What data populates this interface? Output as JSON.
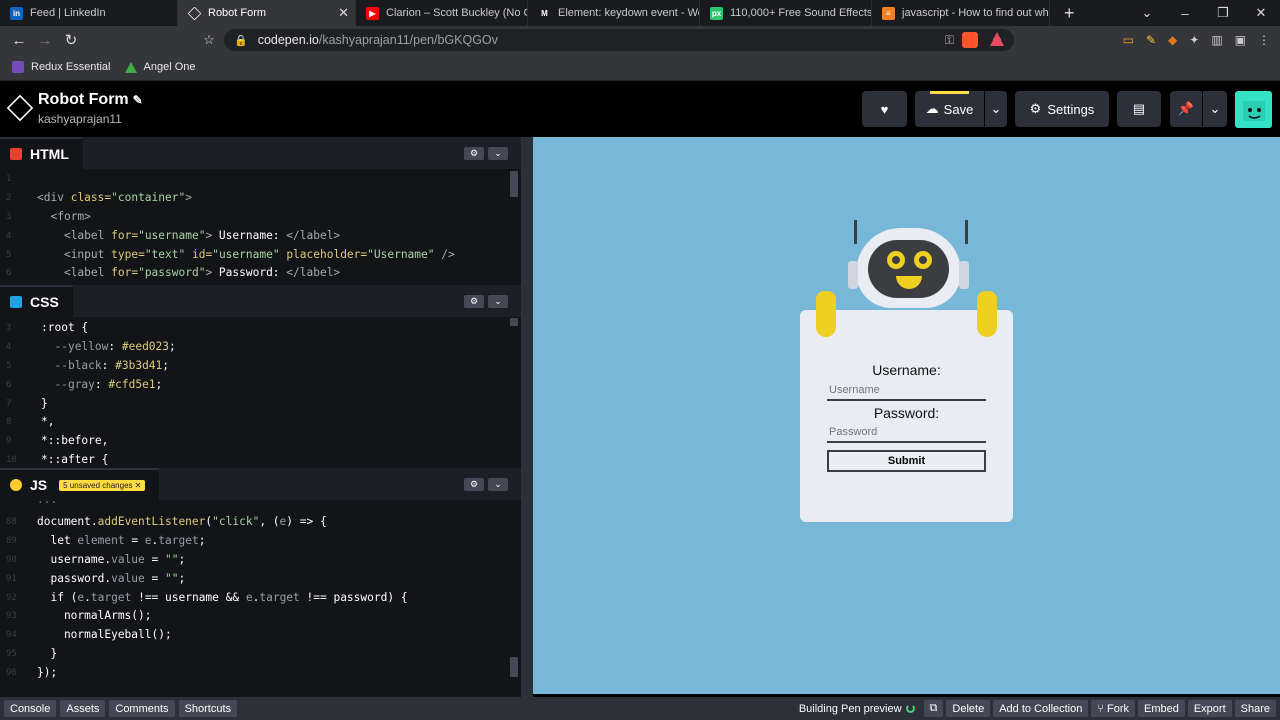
{
  "browser": {
    "tabs": [
      {
        "label": "Feed | LinkedIn",
        "icon": "linkedin-icon",
        "color": "#0a66c2",
        "glyph": "in"
      },
      {
        "label": "Robot Form",
        "icon": "codepen-icon",
        "color": "#35363a",
        "glyph": "◈",
        "active": true
      },
      {
        "label": "Clarion – Scott Buckley (No Copy",
        "icon": "youtube-icon",
        "color": "#ff0000",
        "glyph": "▶"
      },
      {
        "label": "Element: keydown event - Web A",
        "icon": "mdn-icon",
        "color": "#35363a",
        "glyph": "M"
      },
      {
        "label": "110,000+ Free Sound Effects for",
        "icon": "pixabay-icon",
        "color": "#2ec66d",
        "glyph": "px"
      },
      {
        "label": "javascript - How to find out wha",
        "icon": "stackoverflow-icon",
        "color": "#f48024",
        "glyph": "≡"
      }
    ],
    "url_host": "codepen.io",
    "url_path": "/kashyaprajan11/pen/bGKQGOv",
    "bookmarks": [
      {
        "label": "Redux Essential",
        "color": "#764abc"
      },
      {
        "label": "Angel One",
        "color": "#3fae49"
      }
    ]
  },
  "header": {
    "title": "Robot Form",
    "user": "kashyaprajan11",
    "save_label": "Save",
    "settings_label": "Settings"
  },
  "html_panel": {
    "title": "HTML",
    "color": "#e5412f"
  },
  "css_panel": {
    "title": "CSS",
    "color": "#1ea2e4"
  },
  "js_panel": {
    "title": "JS",
    "color": "#ffcb2e",
    "unsaved": "5 unsaved changes"
  },
  "preview": {
    "username_label": "Username:",
    "username_placeholder": "Username",
    "password_label": "Password:",
    "password_placeholder": "Password",
    "submit_label": "Submit"
  },
  "footer": {
    "left": [
      "Console",
      "Assets",
      "Comments",
      "Shortcuts"
    ],
    "status": "Building Pen preview",
    "right": [
      "Delete",
      "Add to Collection",
      "Fork",
      "Embed",
      "Export",
      "Share"
    ]
  }
}
